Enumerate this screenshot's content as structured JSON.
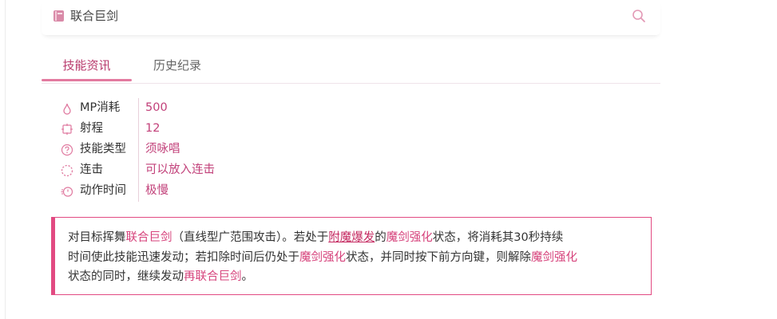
{
  "header": {
    "book_icon": "book-icon",
    "title": "联合巨剑",
    "search_icon": "search-icon"
  },
  "tabs": [
    {
      "label": "技能资讯",
      "active": true
    },
    {
      "label": "历史纪录",
      "active": false
    }
  ],
  "stats": [
    {
      "icon": "mp-drop-icon",
      "label": "MP消耗",
      "value": "500"
    },
    {
      "icon": "range-target-icon",
      "label": "射程",
      "value": "12"
    },
    {
      "icon": "help-circle-icon",
      "label": "技能类型",
      "value": "须咏唱"
    },
    {
      "icon": "combo-dashed-circle-icon",
      "label": "连击",
      "value": "可以放入连击"
    },
    {
      "icon": "timer-icon",
      "label": "动作时间",
      "value": "极慢"
    }
  ],
  "description": {
    "line1": {
      "a": "对目标挥舞",
      "b": "联合巨剑",
      "c": "（直线型广范围攻击）。若处于",
      "d": "附魔爆发",
      "e": "的",
      "f": "魔剑强化",
      "g": "状态，将消耗其30秒持续"
    },
    "line2": {
      "a": "时间使此技能迅速发动；若扣除时间后仍处于",
      "b": "魔剑强化",
      "c": "状态，并同时按下前方向键，则解除",
      "d": "魔剑强化"
    },
    "line3": {
      "a": "状态的同时，继续发动",
      "b": "再联合巨剑",
      "c": "。"
    }
  },
  "colors": {
    "accent": "#e24a82",
    "value_text": "#c2417a",
    "tab_active": "#b83a6c"
  }
}
